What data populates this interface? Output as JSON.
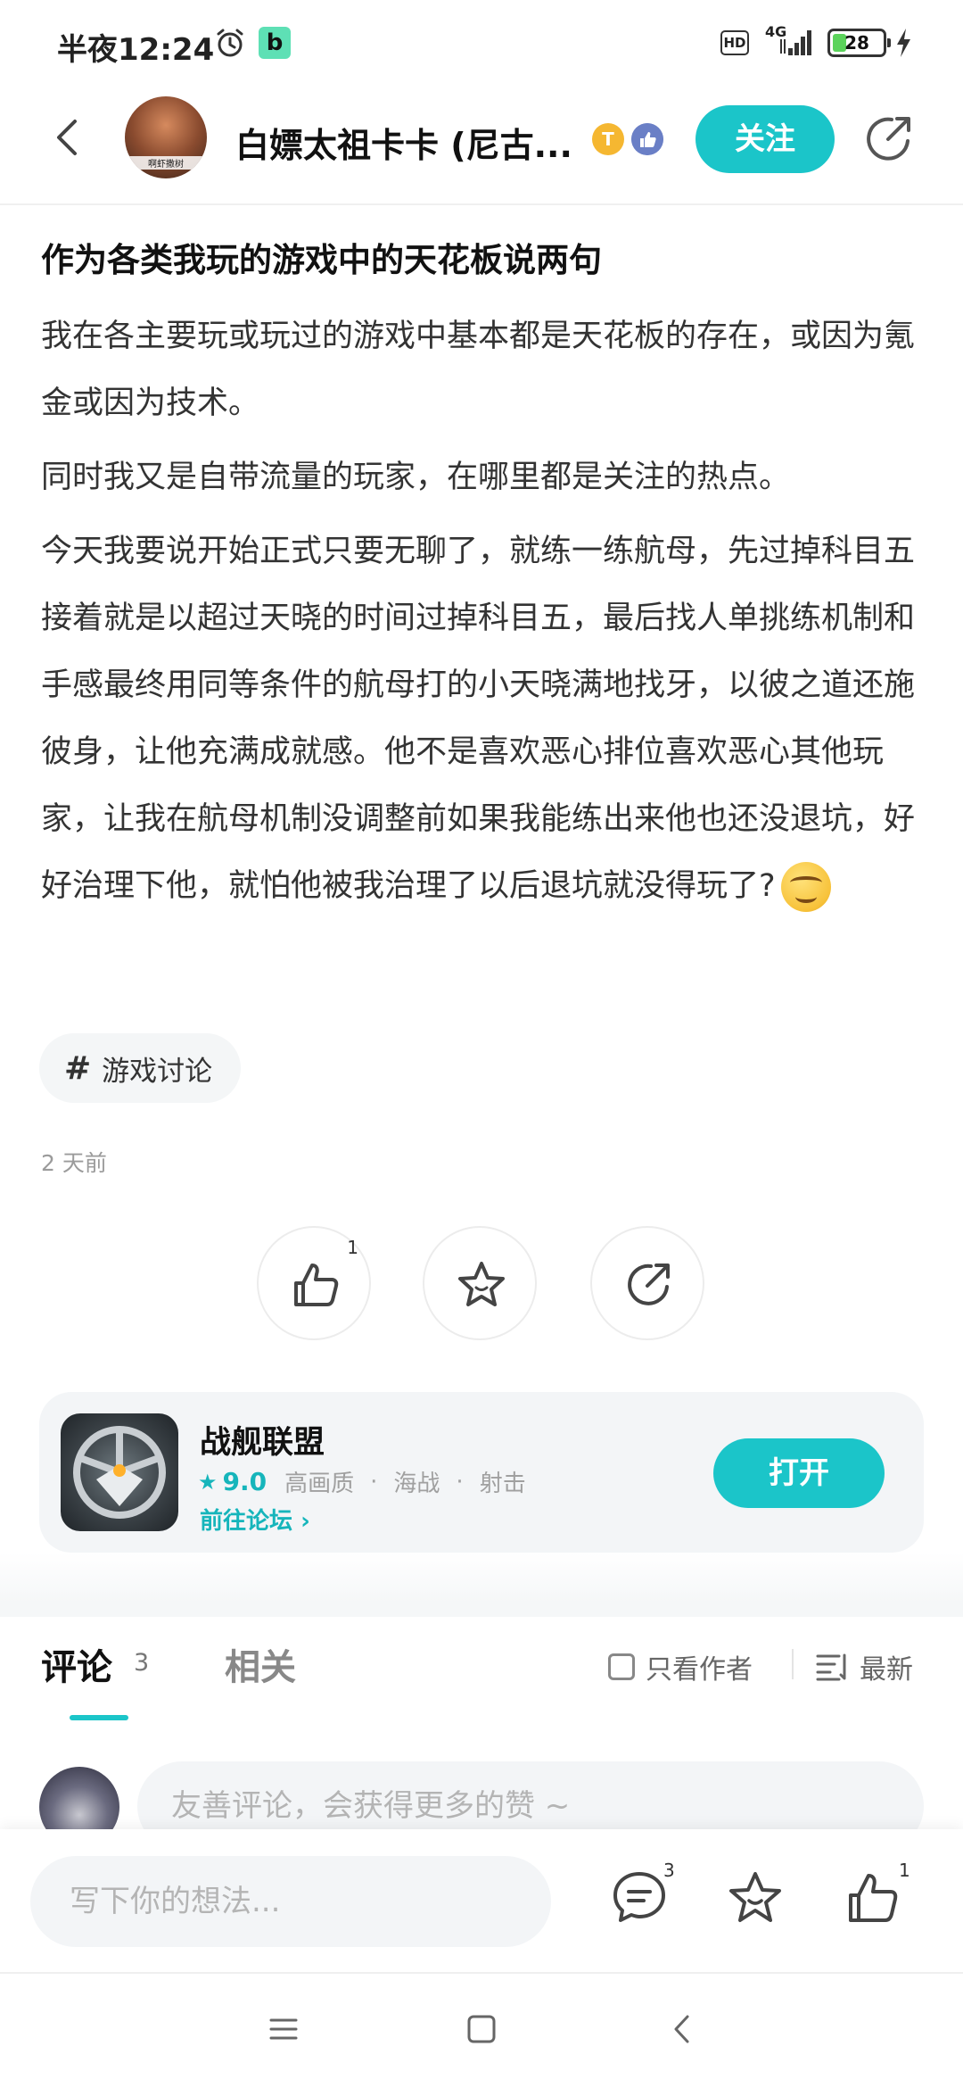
{
  "status_bar": {
    "time": "半夜12:24",
    "app_icon_letter": "b",
    "hd_label": "HD",
    "network": "4G",
    "battery_percent": 28,
    "battery_label": "28"
  },
  "header": {
    "author_name": "白嫖太祖卡卡 (尼古...",
    "avatar_caption": "啊虾撒树",
    "badge_letter": "T",
    "follow_label": "关注"
  },
  "post": {
    "title": "作为各类我玩的游戏中的天花板说两句",
    "paragraphs": [
      "我在各主要玩或玩过的游戏中基本都是天花板的存在，或因为氪金或因为技术。",
      "同时我又是自带流量的玩家，在哪里都是关注的热点。",
      "今天我要说开始正式只要无聊了，就练一练航母，先过掉科目五接着就是以超过天晓的时间过掉科目五，最后找人单挑练机制和手感最终用同等条件的航母打的小天晓满地找牙，以彼之道还施彼身，让他充满成就感。他不是喜欢恶心排位喜欢恶心其他玩家，让我在航母机制没调整前如果我能练出来他也还没退坑，好好治理下他，就怕他被我治理了以后退坑就没得玩了?"
    ],
    "tag": "游戏讨论",
    "time_ago": "2 天前",
    "like_count": "1"
  },
  "game_card": {
    "name": "战舰联盟",
    "rating": "9.0",
    "tags": [
      "高画质",
      "海战",
      "射击"
    ],
    "forum_link": "前往论坛",
    "open_label": "打开"
  },
  "comments": {
    "tab_comments": "评论",
    "comment_count": "3",
    "tab_related": "相关",
    "author_only": "只看作者",
    "sort_label": "最新",
    "input_placeholder": "友善评论，会获得更多的赞 ~"
  },
  "bottom_bar": {
    "write_placeholder": "写下你的想法...",
    "comment_count": "3",
    "like_count": "1"
  },
  "colors": {
    "accent": "#1bc5c9",
    "text": "#222222",
    "muted": "#9b9b9b"
  }
}
